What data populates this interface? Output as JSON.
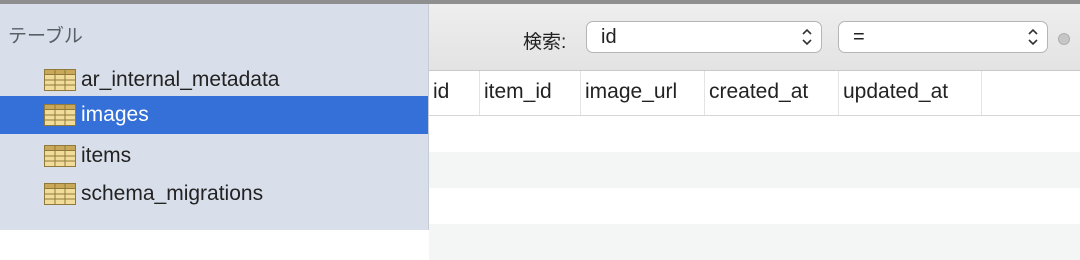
{
  "sidebar": {
    "header": "テーブル",
    "items": [
      {
        "label": "ar_internal_metadata",
        "selected": false
      },
      {
        "label": "images",
        "selected": true
      },
      {
        "label": "items",
        "selected": false
      },
      {
        "label": "schema_migrations",
        "selected": false
      }
    ],
    "icon": "table-icon"
  },
  "toolbar": {
    "search_label": "検索:",
    "field_value": "id",
    "operator_value": "="
  },
  "grid": {
    "columns": [
      "id",
      "item_id",
      "image_url",
      "created_at",
      "updated_at"
    ],
    "rows": []
  },
  "colors": {
    "sidebar_bg": "#d9dfea",
    "selection": "#3470d8",
    "table_icon_fill": "#f1dc9a",
    "table_icon_stroke": "#8f7a3c"
  }
}
